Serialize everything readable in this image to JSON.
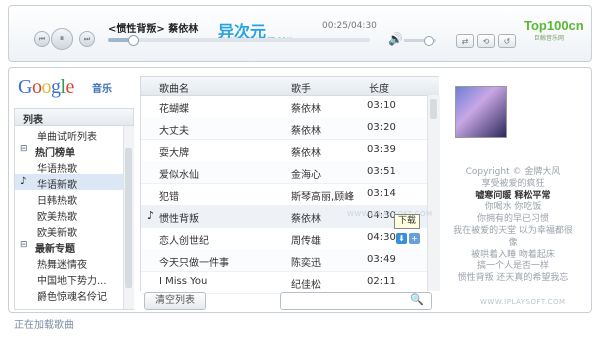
{
  "player": {
    "now_playing": "<惯性背叛> 蔡依林",
    "time": "00:25/04:30",
    "progress": 0.09,
    "volume": 0.75,
    "watermark_main": "异次元",
    "watermark_sub": "WWW.IPLAYSOFT.COM",
    "top100_main": "Top100cn",
    "top100_sub": "巨鲸音乐网"
  },
  "brand": {
    "logo": "Google",
    "music": "音乐"
  },
  "sidebar": {
    "title": "列表",
    "items": [
      {
        "label": "单曲试听列表",
        "indent": 1,
        "marker": ""
      },
      {
        "label": "热门榜单",
        "indent": 0,
        "marker": "⊟"
      },
      {
        "label": "华语热歌",
        "indent": 1,
        "marker": ""
      },
      {
        "label": "华语新歌",
        "indent": 1,
        "marker": "♪"
      },
      {
        "label": "日韩热歌",
        "indent": 1,
        "marker": ""
      },
      {
        "label": "欧美热歌",
        "indent": 1,
        "marker": ""
      },
      {
        "label": "欧美新歌",
        "indent": 1,
        "marker": ""
      },
      {
        "label": "最新专题",
        "indent": 0,
        "marker": "⊟"
      },
      {
        "label": "热舞迷情夜",
        "indent": 1,
        "marker": ""
      },
      {
        "label": "中国地下势力...",
        "indent": 1,
        "marker": ""
      },
      {
        "label": "爵色惊魂名伶记",
        "indent": 1,
        "marker": ""
      }
    ]
  },
  "table": {
    "headers": [
      "歌曲名",
      "歌手",
      "长度"
    ],
    "rows": [
      {
        "title": "花蝴蝶",
        "artist": "蔡依林",
        "length": "03:10"
      },
      {
        "title": "大丈夫",
        "artist": "蔡依林",
        "length": "03:20"
      },
      {
        "title": "耍大牌",
        "artist": "蔡依林",
        "length": "03:39"
      },
      {
        "title": "爱似水仙",
        "artist": "金海心",
        "length": "03:51"
      },
      {
        "title": "犯错",
        "artist": "斯琴高丽,顾峰",
        "length": "03:14"
      },
      {
        "title": "惯性背叛",
        "artist": "蔡依林",
        "length": "04:30",
        "playing": true
      },
      {
        "title": "恋人创世纪",
        "artist": "周传雄",
        "length": "04:30"
      },
      {
        "title": "今天只做一件事",
        "artist": "陈奕迅",
        "length": "03:49"
      },
      {
        "title": "I Miss You",
        "artist": "纪佳松",
        "length": "02:11"
      }
    ],
    "download_tip": "下载",
    "table_watermark": "WWW.IPLAYSOFT.COM",
    "clear_label": "清空列表"
  },
  "lyrics": [
    {
      "text": "Copyright © 金牌大风",
      "current": false
    },
    {
      "text": "享受被爱的疯狂",
      "current": false
    },
    {
      "text": "嘘寒问暖 释松平常",
      "current": true
    },
    {
      "text": "你喝水 你吃饭",
      "current": false
    },
    {
      "text": "你拥有的早已习惯",
      "current": false
    },
    {
      "text": "我在被爱的天堂 以为幸福都很",
      "current": false
    },
    {
      "text": "像",
      "current": false
    },
    {
      "text": "被哄着入睡 吻着起床",
      "current": false
    },
    {
      "text": "搞一个人是否一样",
      "current": false
    },
    {
      "text": "惯性背叛 还天真的希望我忘",
      "current": false
    }
  ],
  "lyrics_watermark": "WWW.IPLAYSOFT.COM",
  "status": "正在加载歌曲"
}
